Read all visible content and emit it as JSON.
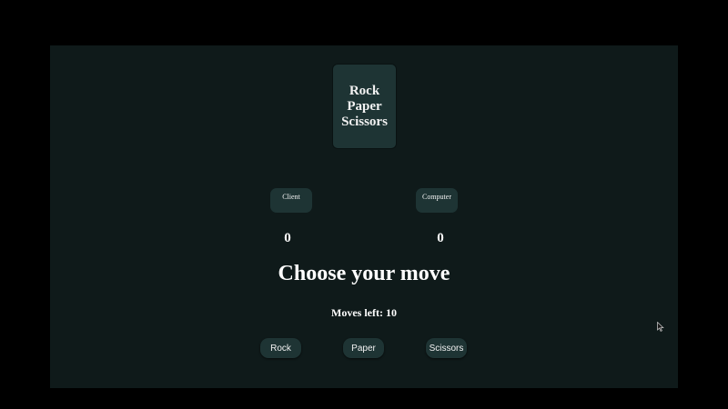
{
  "game": {
    "title_lines": [
      "Rock",
      "Paper",
      "Scissors"
    ],
    "players": {
      "client": {
        "label": "Client",
        "score": "0"
      },
      "computer": {
        "label": "Computer",
        "score": "0"
      }
    },
    "prompt": "Choose your move",
    "moves_left_label": "Moves left:",
    "moves_left_value": "10",
    "move_buttons": [
      "Rock",
      "Paper",
      "Scissors"
    ]
  },
  "colors": {
    "page_background": "#000000",
    "game_background": "#0f1a1a",
    "card_background": "#1e3434",
    "text": "#ffffff"
  },
  "icons": {
    "cursor": "mouse-pointer-icon"
  }
}
